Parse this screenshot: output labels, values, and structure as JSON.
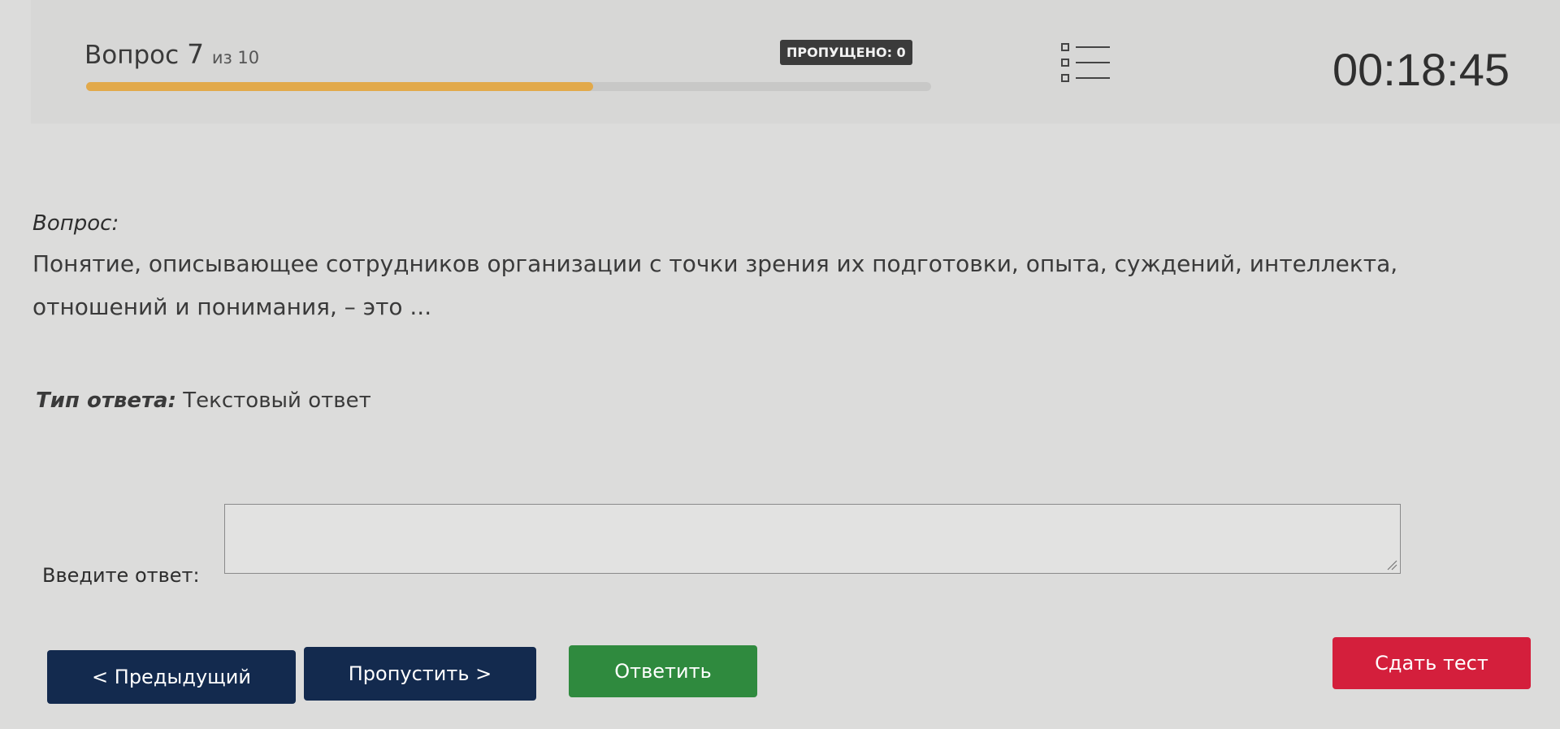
{
  "header": {
    "question_word": "Вопрос",
    "current_question": "7",
    "of_total": "из 10",
    "progress": 0.6,
    "skipped_badge": "ПРОПУЩЕНО: 0",
    "list_icon": "question-list-icon",
    "timer": "00:18:45"
  },
  "question": {
    "label": "Вопрос:",
    "text": "Понятие, описывающее сотрудников организации с точки зрения их подготовки, опыта, суждений, интеллекта, отношений и понимания, – это ...",
    "answer_type_label": "Тип ответа:",
    "answer_type_value": "Текстовый ответ"
  },
  "answer": {
    "label": "Введите ответ:",
    "value": ""
  },
  "buttons": {
    "prev": "< Предыдущий",
    "skip": "Пропустить >",
    "answer": "Ответить",
    "submit": "Сдать тест"
  },
  "colors": {
    "progress": "#e2a94a",
    "nav_button": "#132a4e",
    "answer_button": "#2f8a3e",
    "submit_button": "#d41f3c"
  }
}
